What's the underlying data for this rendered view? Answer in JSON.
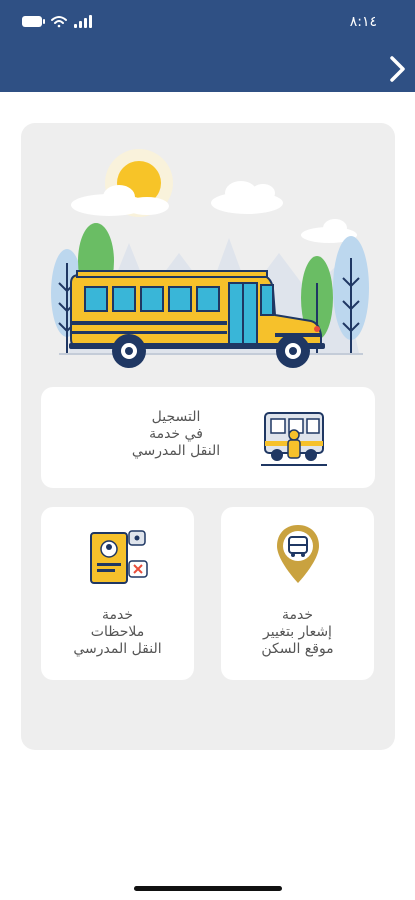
{
  "status_bar": {
    "time": "٨:١٤"
  },
  "cards": {
    "registration": {
      "lines": [
        "التسجيل",
        "في خدمة",
        "النقل المدرسي"
      ]
    },
    "notes": {
      "lines": [
        "خدمة",
        "ملاحظات",
        "النقل المدرسي"
      ]
    },
    "notify": {
      "lines": [
        "خدمة",
        "إشعار بتغيير",
        "موقع السكن"
      ]
    }
  },
  "colors": {
    "header": "#2f5084",
    "panel": "#eeeeee",
    "bus_yellow": "#f6c12b",
    "navy": "#1f3763",
    "gold": "#c9a23f"
  },
  "icons": {
    "back": "chevron-right-icon",
    "registration": "bus-student-icon",
    "notes": "id-card-chat-icon",
    "notify": "bus-location-pin-icon"
  }
}
